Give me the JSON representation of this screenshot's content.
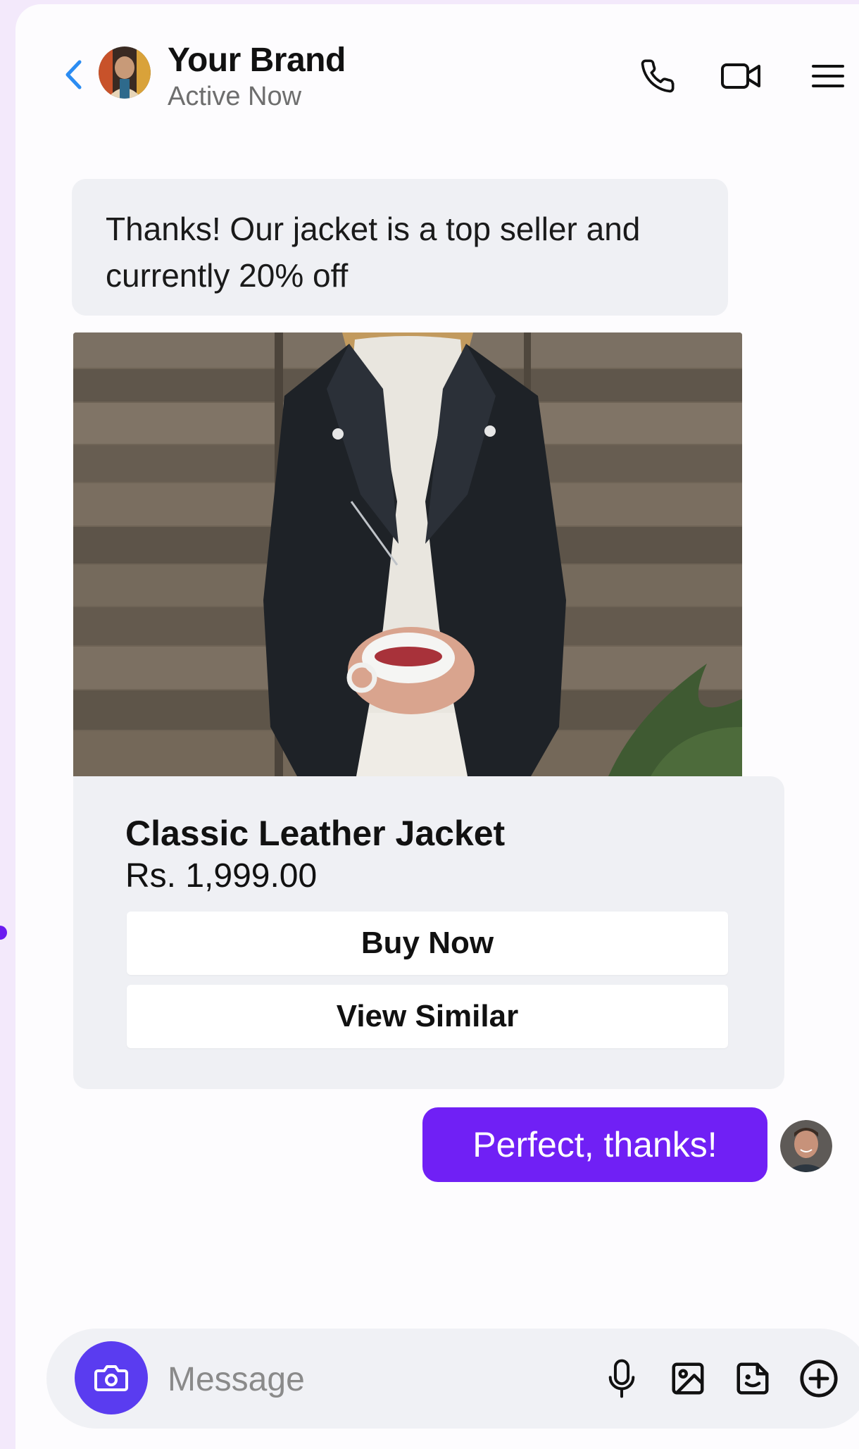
{
  "colors": {
    "accent_blue": "#2b8cf2",
    "outgoing_bubble": "#7020f5",
    "camera_button": "#5a3cf0",
    "incoming_bubble": "#eff0f4",
    "page_background": "#f3e9fb"
  },
  "header": {
    "title": "Your Brand",
    "status": "Active Now",
    "icons": [
      "back-chevron-icon",
      "phone-icon",
      "video-camera-icon",
      "menu-icon"
    ]
  },
  "messages": {
    "incoming_text": "Thanks! Our jacket is a top seller and currently 20% off",
    "outgoing_text": "Perfect, thanks!"
  },
  "product": {
    "title": "Classic Leather Jacket",
    "price": "Rs. 1,999.00",
    "buttons": [
      "Buy Now",
      "View Similar"
    ]
  },
  "composer": {
    "placeholder": "Message",
    "value": "",
    "icons": [
      "camera-icon",
      "microphone-icon",
      "image-icon",
      "sticker-icon",
      "add-icon"
    ]
  }
}
